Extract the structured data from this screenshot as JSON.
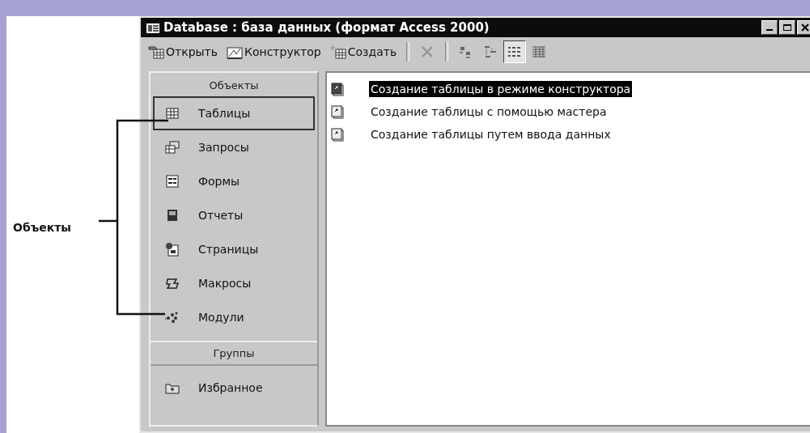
{
  "annotation": {
    "label": "Объекты"
  },
  "window": {
    "title": "Database : база данных (формат Access 2000)"
  },
  "toolbar": {
    "buttons": [
      {
        "kind": "open",
        "label": "Открыть"
      },
      {
        "kind": "design",
        "label": "Конструктор"
      },
      {
        "kind": "new",
        "label": "Создать"
      }
    ],
    "delete": {
      "disabled": true
    },
    "views": [
      {
        "kind": "large",
        "selected": false
      },
      {
        "kind": "small",
        "selected": false
      },
      {
        "kind": "list",
        "selected": true
      },
      {
        "kind": "details",
        "selected": false
      }
    ]
  },
  "sidebar": {
    "objects_header": "Объекты",
    "objects": [
      {
        "kind": "tables",
        "label": "Таблицы",
        "selected": true
      },
      {
        "kind": "queries",
        "label": "Запросы",
        "selected": false
      },
      {
        "kind": "forms",
        "label": "Формы",
        "selected": false
      },
      {
        "kind": "reports",
        "label": "Отчеты",
        "selected": false
      },
      {
        "kind": "pages",
        "label": "Страницы",
        "selected": false
      },
      {
        "kind": "macros",
        "label": "Макросы",
        "selected": false
      },
      {
        "kind": "modules",
        "label": "Модули",
        "selected": false
      }
    ],
    "groups_header": "Группы",
    "groups": [
      {
        "label": "Избранное"
      }
    ]
  },
  "list": {
    "items": [
      {
        "label": "Создание таблицы в режиме конструктора",
        "selected": true
      },
      {
        "label": "Создание таблицы с помощью мастера",
        "selected": false
      },
      {
        "label": "Создание таблицы путем ввода данных",
        "selected": false
      }
    ]
  }
}
